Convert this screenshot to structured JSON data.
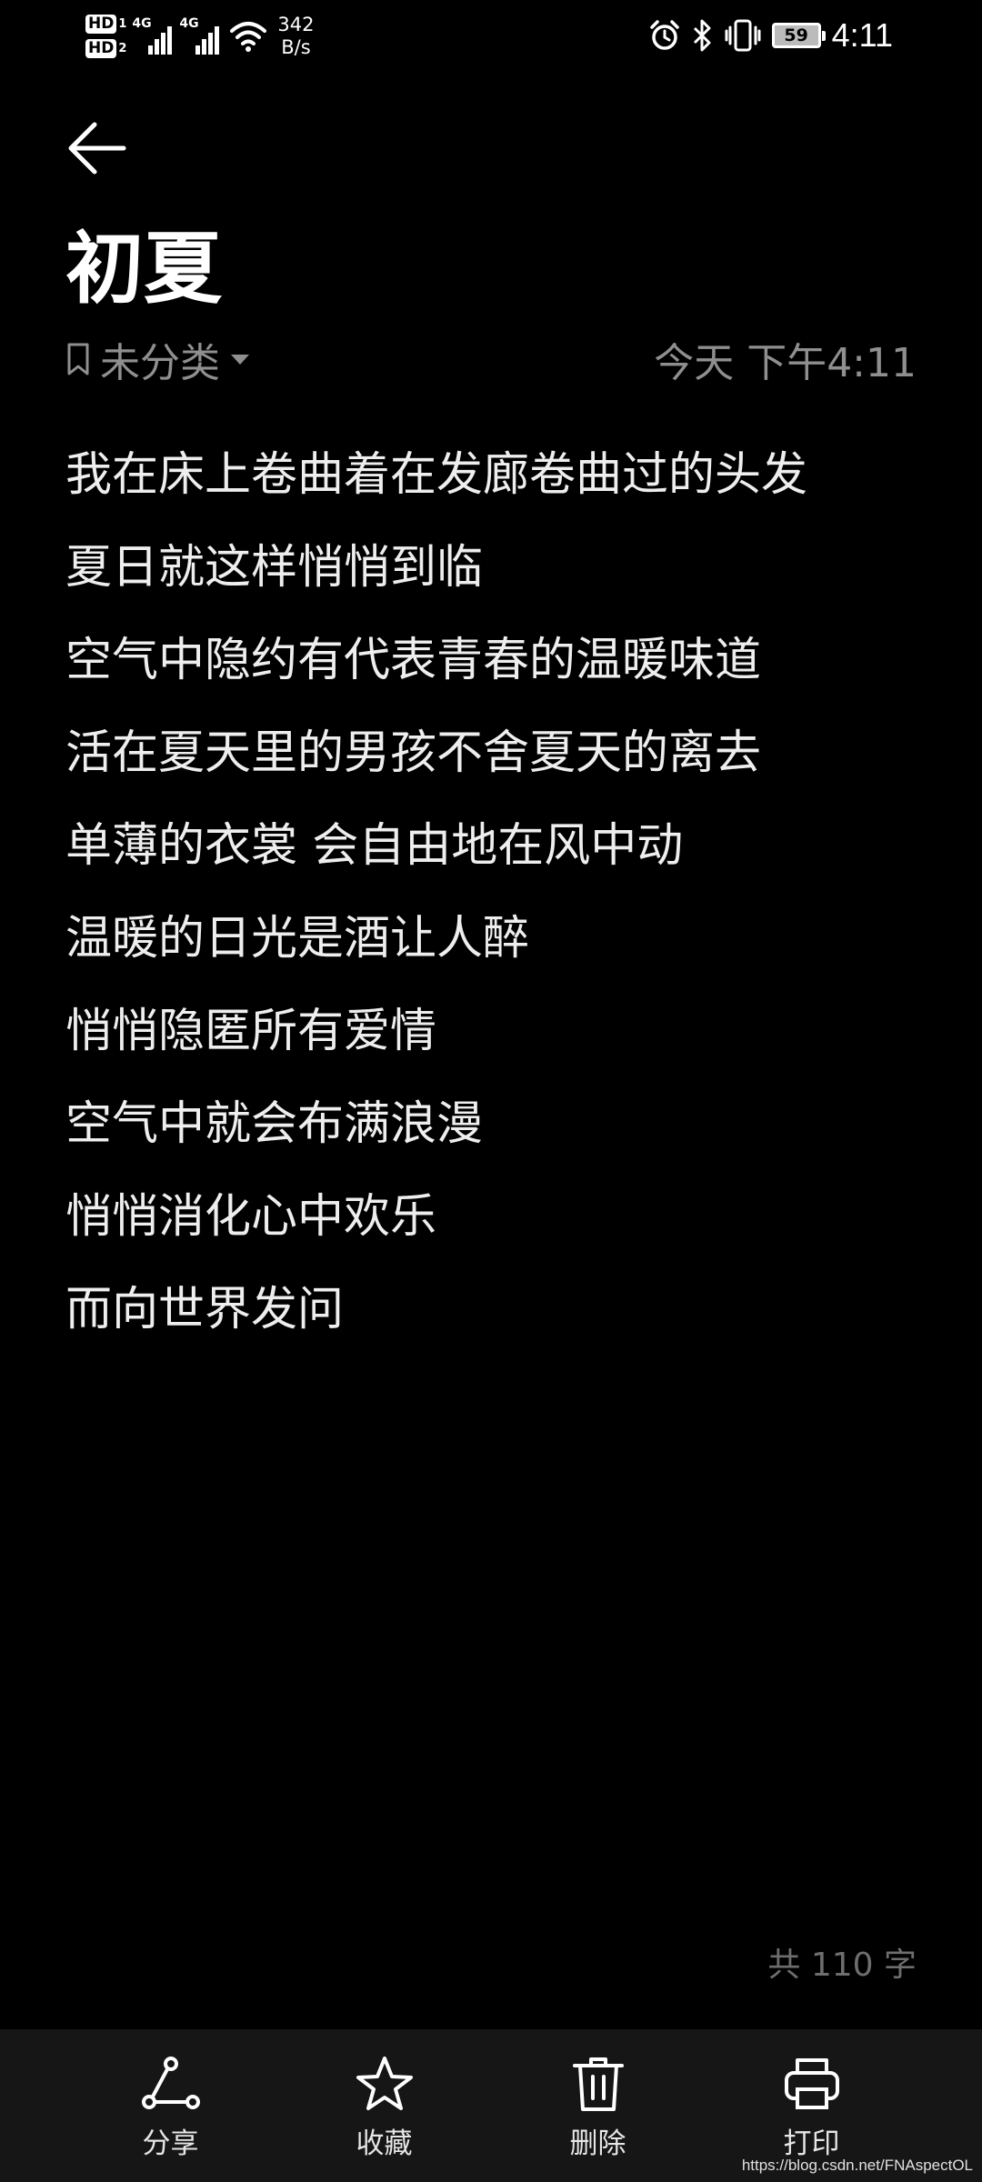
{
  "status_bar": {
    "hd1": "HD",
    "hd1_sub": "1",
    "hd2": "HD",
    "hd2_sub": "2",
    "sim1_label": "4G",
    "sim2_label": "4G",
    "net_speed_value": "342",
    "net_speed_unit": "B/s",
    "battery": "59",
    "time": "4:11"
  },
  "note": {
    "title": "初夏",
    "category": "未分类",
    "datetime": "今天 下午4:11",
    "lines": [
      "我在床上卷曲着在发廊卷曲过的头发",
      "夏日就这样悄悄到临",
      "空气中隐约有代表青春的温暖味道",
      "活在夏天里的男孩不舍夏天的离去",
      "单薄的衣裳 会自由地在风中动",
      "温暖的日光是酒让人醉",
      "悄悄隐匿所有爱情",
      "空气中就会布满浪漫",
      "悄悄消化心中欢乐",
      "而向世界发问"
    ],
    "word_count": "共 110 字"
  },
  "toolbar": {
    "share": "分享",
    "favorite": "收藏",
    "delete": "删除",
    "print": "打印"
  },
  "watermark": "https://blog.csdn.net/FNAspectOL"
}
